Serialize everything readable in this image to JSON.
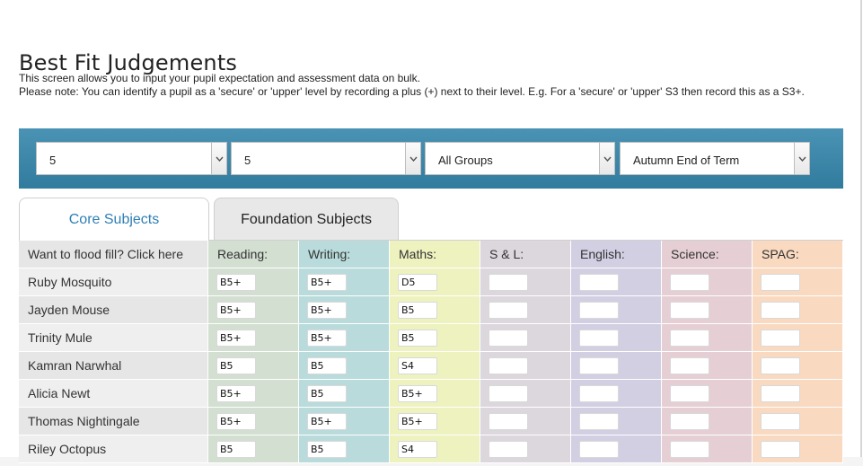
{
  "page": {
    "title": "Best Fit Judgements",
    "intro_line1": "This screen allows you to input your pupil expectation and assessment data on bulk.",
    "intro_line2": "Please note: You can identify a pupil as a 'secure' or 'upper' level by recording a plus (+) next to their level. E.g. For a 'secure' or 'upper' S3 then record this as a S3+."
  },
  "filters": [
    {
      "value": "5",
      "icon": "chevron-down-icon"
    },
    {
      "value": "5",
      "icon": "chevron-down-icon"
    },
    {
      "value": "All Groups",
      "icon": "chevron-down-icon"
    },
    {
      "value": "Autumn End of Term",
      "icon": "chevron-down-icon"
    }
  ],
  "tabs": [
    {
      "label": "Core Subjects",
      "active": true
    },
    {
      "label": "Foundation Subjects",
      "active": false
    }
  ],
  "grid": {
    "flood_fill_label": "Want to flood fill? Click here",
    "subjects": [
      {
        "label": "Reading:",
        "color": "#d3dfd1"
      },
      {
        "label": "Writing:",
        "color": "#b9dbdb"
      },
      {
        "label": "Maths:",
        "color": "#eef2bf"
      },
      {
        "label": "S & L:",
        "color": "#dcd6dd"
      },
      {
        "label": "English:",
        "color": "#d2cfe3"
      },
      {
        "label": "Science:",
        "color": "#e5cfd4"
      },
      {
        "label": "SPAG:",
        "color": "#f9d9c0"
      }
    ],
    "pupils": [
      {
        "name": "Ruby Mosquito",
        "scores": [
          "B5+",
          "B5+",
          "D5",
          "",
          "",
          "",
          ""
        ]
      },
      {
        "name": "Jayden Mouse",
        "scores": [
          "B5+",
          "B5+",
          "B5",
          "",
          "",
          "",
          ""
        ]
      },
      {
        "name": "Trinity Mule",
        "scores": [
          "B5+",
          "B5+",
          "B5",
          "",
          "",
          "",
          ""
        ]
      },
      {
        "name": "Kamran Narwhal",
        "scores": [
          "B5",
          "B5",
          "S4",
          "",
          "",
          "",
          ""
        ]
      },
      {
        "name": "Alicia Newt",
        "scores": [
          "B5+",
          "B5",
          "B5+",
          "",
          "",
          "",
          ""
        ]
      },
      {
        "name": "Thomas Nightingale",
        "scores": [
          "B5+",
          "B5+",
          "B5+",
          "",
          "",
          "",
          ""
        ]
      },
      {
        "name": "Riley Octopus",
        "scores": [
          "B5",
          "B5",
          "S4",
          "",
          "",
          "",
          ""
        ]
      }
    ]
  }
}
